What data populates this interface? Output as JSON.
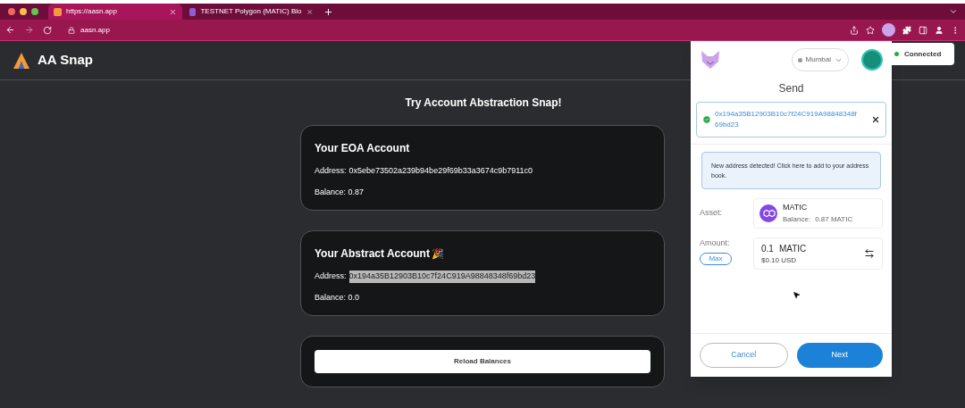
{
  "browser": {
    "tabs": [
      {
        "title": "https://aasn.app",
        "selected": true
      },
      {
        "title": "TESTNET Polygon (MATIC) Blo",
        "selected": false
      }
    ],
    "url": "aasn.app"
  },
  "app": {
    "title": "AA Snap",
    "heading": "Try Account Abstraction Snap!",
    "cards": [
      {
        "title": "Your EOA Account",
        "address_label": "Address:",
        "address": "0x5ebe73502a239b94be29f69b33a3674c9b7911c0",
        "address_selected": false,
        "balance": "Balance: 0.87"
      },
      {
        "title": "Your Abstract Account",
        "emoji": "🎉",
        "address_label": "Address:",
        "address": "0x194a35B12903B10c7f24C919A98848348f69bd23",
        "address_selected": true,
        "balance": "Balance: 0.0"
      }
    ],
    "reload_button": "Reload Balances"
  },
  "wallet": {
    "network": "Mumbai",
    "connected": "Connected",
    "title": "Send",
    "recipient": "0x194a35B12903B10c7f24C919A98848348f69bd23",
    "notice": "New address detected! Click here to add to your address book.",
    "asset_label": "Asset:",
    "asset_name": "MATIC",
    "asset_balance_label": "Balance:",
    "asset_balance": "0.87 MATIC",
    "amount_label": "Amount:",
    "max_button": "Max",
    "amount": "0.1",
    "amount_unit": "MATIC",
    "amount_fiat": "$0.10 USD",
    "cancel": "Cancel",
    "next": "Next"
  }
}
